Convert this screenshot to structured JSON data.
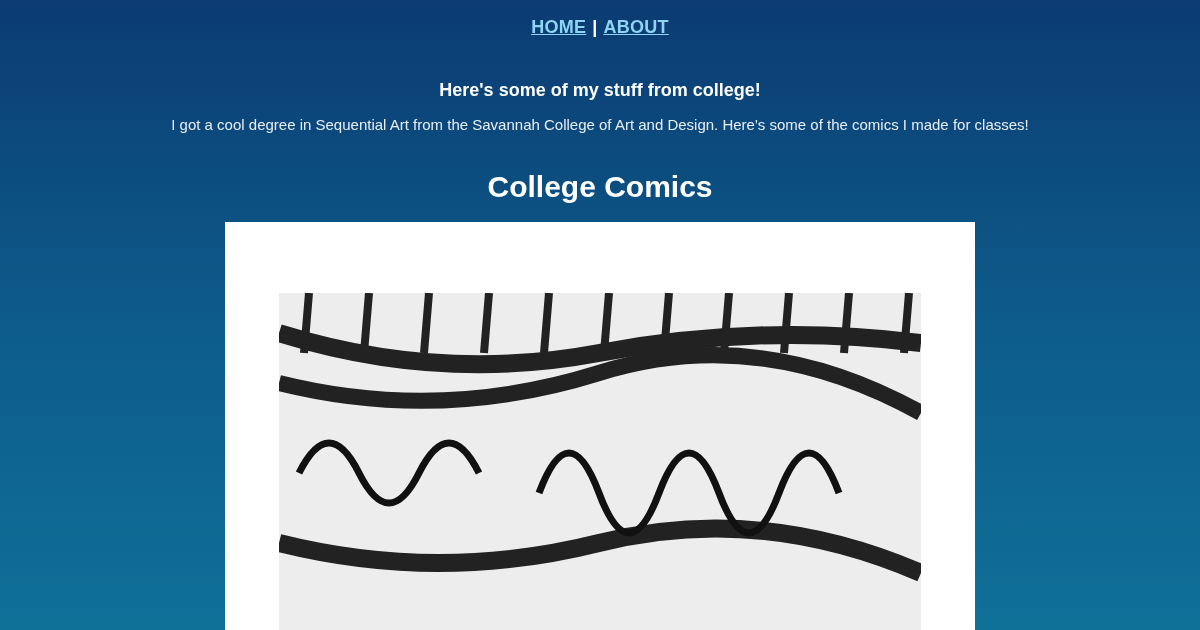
{
  "nav": {
    "links": [
      "HOME",
      "ABOUT"
    ],
    "separator": "|"
  },
  "intro": {
    "heading": "Here's some of my stuff from college!",
    "text": "I got a cool degree in Sequential Art from the Savannah College of Art and Design. Here's some of the comics I made for classes!"
  },
  "section": {
    "title": "College Comics"
  }
}
